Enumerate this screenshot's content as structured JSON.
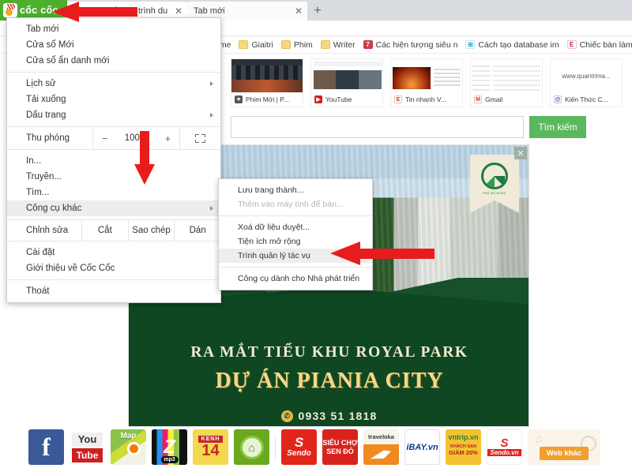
{
  "browser": {
    "name": "Cốc Cốc",
    "logo_text": "cốc cốc",
    "tabs": [
      {
        "title": "Cách sửa lỗi trình duyệt C",
        "close": "✕",
        "favicon": "@",
        "state": "active"
      },
      {
        "title": "Tab mới",
        "close": "✕",
        "favicon": "",
        "state": "inactive"
      }
    ],
    "new_tab_button": "+"
  },
  "bookmarks": [
    {
      "label": "ame",
      "icon": "folder-icon",
      "glyph": ""
    },
    {
      "label": "Giaitri",
      "icon": "folder-icon",
      "glyph": ""
    },
    {
      "label": "Phim",
      "icon": "folder-icon",
      "glyph": ""
    },
    {
      "label": "Writer",
      "icon": "folder-icon",
      "glyph": ""
    },
    {
      "label": "Các hiện tượng siêu n",
      "icon": "page-icon-red",
      "glyph": "7"
    },
    {
      "label": "Cách tạo database im",
      "icon": "page-icon-cyan",
      "glyph": "⊞"
    },
    {
      "label": "Chiếc bàn làm việc si",
      "icon": "page-icon-pink",
      "glyph": "E"
    }
  ],
  "menu": {
    "groups": [
      {
        "items": [
          {
            "label": "Tab mới",
            "submenu": false
          },
          {
            "label": "Cửa sổ Mới",
            "submenu": false
          },
          {
            "label": "Cửa sổ ẩn danh mới",
            "submenu": false
          }
        ]
      },
      {
        "items": [
          {
            "label": "Lịch sử",
            "submenu": true
          },
          {
            "label": "Tải xuống",
            "submenu": false
          },
          {
            "label": "Dấu trang",
            "submenu": true
          }
        ]
      }
    ],
    "zoom": {
      "label": "Thu phóng",
      "minus": "−",
      "value": "100%",
      "plus": "+",
      "fullscreen_icon": "fullscreen-icon"
    },
    "tools_group": [
      {
        "label": "In...",
        "submenu": false
      },
      {
        "label": "Truyền...",
        "submenu": false
      },
      {
        "label": "Tìm...",
        "submenu": false
      },
      {
        "label": "Công cụ khác",
        "submenu": true,
        "highlighted": true
      }
    ],
    "edit_row": {
      "label": "Chỉnh sửa",
      "cut": "Cắt",
      "copy": "Sao chép",
      "paste": "Dán"
    },
    "footer_group": [
      {
        "label": "Cài đặt"
      },
      {
        "label": "Giới thiệu về Cốc Cốc"
      }
    ],
    "exit": {
      "label": "Thoát"
    }
  },
  "submenu": {
    "items": [
      {
        "label": "Lưu trang thành...",
        "disabled": false,
        "highlighted": false
      },
      {
        "label": "Thêm vào máy tính để bàn...",
        "disabled": true,
        "highlighted": false
      },
      {
        "sep": true
      },
      {
        "label": "Xoá dữ liệu duyệt...",
        "disabled": false,
        "highlighted": false
      },
      {
        "label": "Tiện ích mở rộng",
        "disabled": false,
        "highlighted": false
      },
      {
        "label": "Trình quản lý tác vụ",
        "disabled": false,
        "highlighted": true
      },
      {
        "sep": true
      },
      {
        "label": "Công cụ dành cho Nhà phát triển",
        "disabled": false,
        "highlighted": false
      }
    ]
  },
  "newtab": {
    "thumbnails": [
      {
        "label": "Phim Mới | P...",
        "icon": "film-icon"
      },
      {
        "label": "YouTube",
        "icon": "youtube-icon"
      },
      {
        "label": "Tin nhanh V...",
        "icon": "vnexpress-icon"
      },
      {
        "label": "Gmail",
        "icon": "gmail-icon"
      },
      {
        "label": "Kiến Thức C...",
        "icon": "at-icon",
        "preview_text": "www.quantrima..."
      }
    ],
    "search": {
      "value": "",
      "placeholder": "",
      "button_label": "Tìm kiếm"
    },
    "hero": {
      "headline": "RA MẮT TIỂU KHU ROYAL PARK",
      "project": "DỰ ÁN PIANIA CITY",
      "phone": "0933 51 1818",
      "phone_icon": "phone-icon",
      "logo_text": "PHÚ MỸ HƯNG",
      "close_icon": "ad-close-icon"
    },
    "apps": [
      {
        "name": "Facebook",
        "label": "f"
      },
      {
        "name": "YouTube",
        "label_top": "You",
        "label_bottom": "Tube"
      },
      {
        "name": "Map",
        "label": "Map"
      },
      {
        "name": "Zing MP3",
        "label": "Z",
        "sub": "mp3"
      },
      {
        "name": "Kênh 14",
        "label_top": "KENH",
        "label": "14"
      },
      {
        "name": "Cốc Cốc",
        "label": "⌂"
      },
      {
        "name": "Sendo",
        "label_top": "S",
        "label": "Sendo"
      },
      {
        "name": "Siêu chợ Sen Đỏ",
        "label": "SIÊU CHỢ SEN ĐỎ"
      },
      {
        "name": "Traveloka",
        "label": "traveloka"
      },
      {
        "name": "iBay.vn",
        "label": "iBAY.vn"
      },
      {
        "name": "VNtrip",
        "label": "vntrip.vn",
        "sub1": "KHÁCH SẠN",
        "sub2": "GIẢM 20%"
      },
      {
        "name": "Sendo.vn",
        "label": "S",
        "sub": "Sendo.vn"
      },
      {
        "name": "Web khác",
        "label": "Web khác"
      }
    ]
  },
  "annotations": {
    "arrow_tab": "red-arrow-pointing-to-tab",
    "arrow_down": "red-arrow-pointing-down-to-more-tools",
    "arrow_task": "red-arrow-pointing-to-task-manager"
  },
  "colors": {
    "brand_green": "#4caf2d",
    "search_button": "#5cb85c",
    "annotation_red": "#e81c1c",
    "hero_green": "#0f4722",
    "hero_gold": "#f0d98a"
  }
}
